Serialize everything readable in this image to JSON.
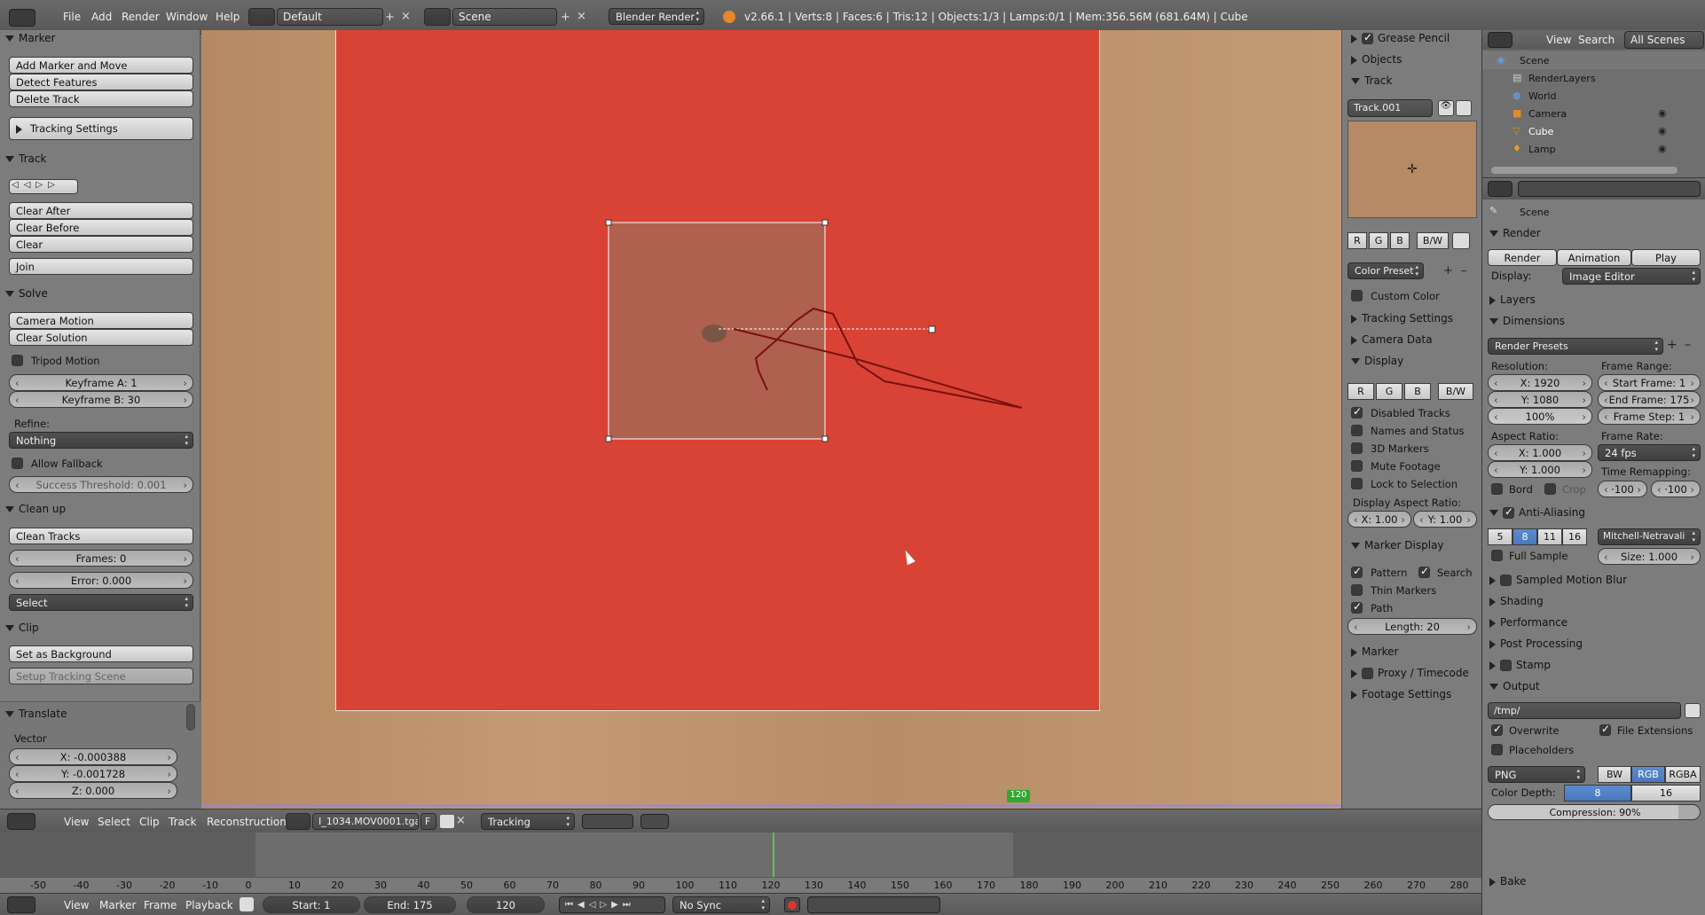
{
  "topbar": {
    "menus": [
      "File",
      "Add",
      "Render",
      "Window",
      "Help"
    ],
    "layout": "Default",
    "scene": "Scene",
    "engine": "Blender Render",
    "stats": "v2.66.1 | Verts:8 | Faces:6 | Tris:12 | Objects:1/3 | Lamps:0/1 | Mem:356.56M (681.64M) | Cube"
  },
  "left": {
    "marker": {
      "title": "Marker",
      "buttons": [
        "Add Marker and Move",
        "Detect Features",
        "Delete Track"
      ],
      "tracking_settings": "Tracking Settings"
    },
    "track": {
      "title": "Track",
      "buttons": [
        "Clear After",
        "Clear Before",
        "Clear",
        "Join"
      ]
    },
    "solve": {
      "title": "Solve",
      "buttons": [
        "Camera Motion",
        "Clear Solution"
      ],
      "tripod": "Tripod Motion",
      "keyframe_a": "Keyframe A: 1",
      "keyframe_b": "Keyframe B: 30",
      "refine_label": "Refine:",
      "refine_value": "Nothing",
      "allow_fallback": "Allow Fallback",
      "success_threshold": "Success Threshold: 0.001"
    },
    "cleanup": {
      "title": "Clean up",
      "clean_tracks": "Clean Tracks",
      "frames": "Frames: 0",
      "error": "Error: 0.000",
      "select": "Select"
    },
    "clip": {
      "title": "Clip",
      "set_bg": "Set as Background",
      "setup_scene": "Setup Tracking Scene"
    },
    "translate": {
      "title": "Translate",
      "vector": "Vector",
      "x": "X: -0.000388",
      "y": "Y: -0.001728",
      "z": "Z: 0.000"
    }
  },
  "viewer": {
    "frame_marker": "120"
  },
  "clip_header": {
    "menus": [
      "View",
      "Select",
      "Clip",
      "Track",
      "Reconstruction"
    ],
    "clip_name": "I_1034.MOV0001.tga",
    "f": "F",
    "mode": "Tracking"
  },
  "timeline_ticks": [
    "-50",
    "-40",
    "-30",
    "-20",
    "-10",
    "0",
    "10",
    "20",
    "30",
    "40",
    "50",
    "60",
    "70",
    "80",
    "90",
    "100",
    "110",
    "120",
    "130",
    "140",
    "150",
    "160",
    "170",
    "180",
    "190",
    "200",
    "210",
    "220",
    "230",
    "240",
    "250",
    "260",
    "270",
    "280"
  ],
  "timeline_header": {
    "menus": [
      "View",
      "Marker",
      "Frame",
      "Playback"
    ],
    "start": "Start: 1",
    "end": "End: 175",
    "current": "120",
    "sync": "No Sync"
  },
  "tool_props": {
    "grease_pencil": "Grease Pencil",
    "objects": "Objects",
    "track": "Track",
    "track_name": "Track.001",
    "rgb": [
      "R",
      "G",
      "B"
    ],
    "bw": "B/W",
    "color_preset": "Color Preset",
    "custom_color": "Custom Color",
    "tracking_settings": "Tracking Settings",
    "camera_data": "Camera Data",
    "display": "Display",
    "display_checks": [
      "Disabled Tracks",
      "Names and Status",
      "3D Markers",
      "Mute Footage",
      "Lock to Selection"
    ],
    "display_aspect": "Display Aspect Ratio:",
    "aspect_x": "X: 1.00",
    "aspect_y": "Y: 1.00",
    "marker_display": "Marker Display",
    "pattern": "Pattern",
    "search": "Search",
    "thin": "Thin Markers",
    "path": "Path",
    "length": "Length: 20",
    "marker": "Marker",
    "proxy": "Proxy / Timecode",
    "footage": "Footage Settings"
  },
  "outliner": {
    "menus": [
      "View",
      "Search"
    ],
    "filter": "All Scenes",
    "items": [
      "Scene",
      "RenderLayers",
      "World",
      "Camera",
      "Cube",
      "Lamp"
    ]
  },
  "props": {
    "context": "Scene",
    "render": "Render",
    "render_btn": "Render",
    "anim_btn": "Animation",
    "play_btn": "Play",
    "display_label": "Display:",
    "display_value": "Image Editor",
    "layers": "Layers",
    "dimensions": "Dimensions",
    "presets": "Render Presets",
    "resolution": "Resolution:",
    "res_x": "X: 1920",
    "res_y": "Y: 1080",
    "res_pct": "100%",
    "frame_range": "Frame Range:",
    "start_frame": "Start Frame: 1",
    "end_frame": "End Frame: 175",
    "frame_step": "Frame Step: 1",
    "aspect": "Aspect Ratio:",
    "asp_x": "X: 1.000",
    "asp_y": "Y: 1.000",
    "frame_rate": "Frame Rate:",
    "fps": "24 fps",
    "bord": "Bord",
    "crop": "Crop",
    "time_remap": "Time Remapping:",
    "remap_old": "·100",
    "remap_new": "·100",
    "anti_aliasing": "Anti-Aliasing",
    "aa_samples": [
      "5",
      "8",
      "11",
      "16"
    ],
    "filter": "Mitchell-Netravali",
    "full_sample": "Full Sample",
    "size": "Size: 1.000",
    "motion_blur": "Sampled Motion Blur",
    "shading": "Shading",
    "performance": "Performance",
    "post_processing": "Post Processing",
    "stamp": "Stamp",
    "output": "Output",
    "path": "/tmp/",
    "overwrite": "Overwrite",
    "file_ext": "File Extensions",
    "placeholders": "Placeholders",
    "format": "PNG",
    "bw": "BW",
    "rgb": "RGB",
    "rgba": "RGBA",
    "color_depth": "Color Depth:",
    "depth8": "8",
    "depth16": "16",
    "compression": "Compression: 90%",
    "bake": "Bake"
  }
}
